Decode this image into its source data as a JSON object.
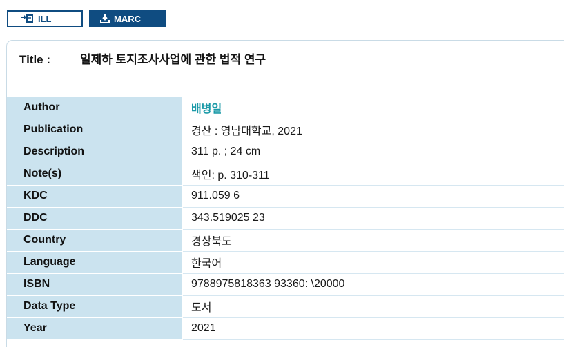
{
  "toolbar": {
    "ill_label": "ILL",
    "marc_label": "MARC"
  },
  "record": {
    "title_label": "Title :",
    "title": "일제하 토지조사사업에 관한 법적 연구",
    "fields": {
      "author": {
        "label": "Author",
        "value": "배병일"
      },
      "publication": {
        "label": "Publication",
        "value": "경산 : 영남대학교, 2021"
      },
      "description": {
        "label": "Description",
        "value": "311 p. ; 24 cm"
      },
      "notes": {
        "label": "Note(s)",
        "value": "색인: p. 310-311"
      },
      "kdc": {
        "label": "KDC",
        "value": "911.059 6"
      },
      "ddc": {
        "label": "DDC",
        "value": "343.519025 23"
      },
      "country": {
        "label": "Country",
        "value": "경상북도"
      },
      "language": {
        "label": "Language",
        "value": "한국어"
      },
      "isbn": {
        "label": "ISBN",
        "value": "9788975818363 93360: \\20000"
      },
      "data_type": {
        "label": "Data Type",
        "value": "도서"
      },
      "year": {
        "label": "Year",
        "value": "2021"
      }
    }
  },
  "colors": {
    "brand": "#0f4c81",
    "label_bg": "#cbe3ef",
    "link": "#1b9aa8"
  },
  "icons": {
    "ill": "interlibrary-loan-icon",
    "marc": "download-icon"
  }
}
